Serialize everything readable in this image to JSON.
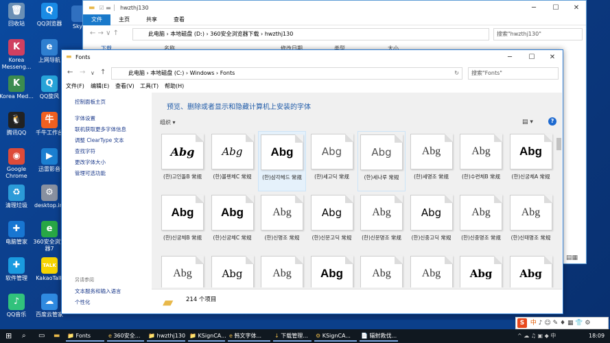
{
  "desktop": {
    "icons": [
      {
        "label": "回收站",
        "glyph": "🗑",
        "color": "#6a8fb5"
      },
      {
        "label": "QQ浏览器",
        "glyph": "Q",
        "color": "#1a8be5"
      },
      {
        "label": "Korea Messeng...",
        "glyph": "K",
        "color": "#d04060"
      },
      {
        "label": "上网导航",
        "glyph": "e",
        "color": "#2f7fd0"
      },
      {
        "label": "Korea Med...",
        "glyph": "K",
        "color": "#3c8c50"
      },
      {
        "label": "QQ旋风",
        "glyph": "Q",
        "color": "#27a3d8"
      },
      {
        "label": "腾讯QQ",
        "glyph": "🐧",
        "color": "#222222"
      },
      {
        "label": "千牛工作台",
        "glyph": "牛",
        "color": "#f06020"
      },
      {
        "label": "Google Chrome",
        "glyph": "◉",
        "color": "#dd4b39"
      },
      {
        "label": "迅雷影音",
        "glyph": "▶",
        "color": "#1b7fd1"
      },
      {
        "label": "清理垃圾",
        "glyph": "♻",
        "color": "#2b9bd8"
      },
      {
        "label": "desktop.ini",
        "glyph": "⚙",
        "color": "#8890a0"
      },
      {
        "label": "电脑管家",
        "glyph": "✚",
        "color": "#1876d2"
      },
      {
        "label": "360安全浏览器7",
        "glyph": "e",
        "color": "#28a745"
      },
      {
        "label": "软件管理",
        "glyph": "✚",
        "color": "#1a9be0"
      },
      {
        "label": "KakaoTalk",
        "glyph": "TALK",
        "color": "#f7d400"
      },
      {
        "label": "QQ音乐",
        "glyph": "♪",
        "color": "#31c27c"
      },
      {
        "label": "百度云管家",
        "glyph": "☁",
        "color": "#2f8ae0"
      }
    ],
    "truncated_sky": "Sky"
  },
  "back_window": {
    "title": "hwzthj130",
    "ribbon": [
      "文件",
      "主页",
      "共享",
      "查看"
    ],
    "path": [
      "此电脑",
      "本地磁盘 (D:)",
      "360安全浏览器下载",
      "hwzthj130"
    ],
    "search_placeholder": "搜索\"hwzthj130\"",
    "nav_item": "下载",
    "columns": [
      "名称",
      "修改日期",
      "类型",
      "大小"
    ]
  },
  "front_window": {
    "title": "Fonts",
    "path": [
      "此电脑",
      "本地磁盘 (C:)",
      "Windows",
      "Fonts"
    ],
    "search_placeholder": "搜索\"Fonts\"",
    "menu": [
      "文件(F)",
      "编辑(E)",
      "查看(V)",
      "工具(T)",
      "帮助(H)"
    ],
    "side": {
      "home": "控制面板主页",
      "links": [
        "字体设置",
        "联机获取更多字体信息",
        "调整 ClearType 文本",
        "查找字符",
        "更改字体大小",
        "管理可选功能"
      ],
      "see_also_header": "另请参阅",
      "see_also": [
        "文本服务和输入语言",
        "个性化"
      ]
    },
    "heading": "预览、删除或者显示和隐藏计算机上安装的字体",
    "organize": "组织 ▾",
    "sample": "Abg",
    "fonts": [
      {
        "name": "(한)고인돌B 常规",
        "style": "script"
      },
      {
        "name": "(한)볼펜체C 常规",
        "style": "script2"
      },
      {
        "name": "(한)삼각헤드 常规",
        "style": "bold",
        "selected": true
      },
      {
        "name": "(한)세고딕 常规",
        "style": "light"
      },
      {
        "name": "(한)세나루 常规",
        "style": "light",
        "hover": true
      },
      {
        "name": "(한)세명조 常规",
        "style": "serif"
      },
      {
        "name": "(한)수련체B 常规",
        "style": "serif"
      },
      {
        "name": "(한)신궁체A 常规",
        "style": "bold"
      },
      {
        "name": "(한)신궁체B 常规",
        "style": "bold"
      },
      {
        "name": "(한)신궁체C 常规",
        "style": "bold"
      },
      {
        "name": "(한)신명조 常规",
        "style": "serif"
      },
      {
        "name": "(한)신문고딕 常规",
        "style": "sans"
      },
      {
        "name": "(한)신문명조 常规",
        "style": "serif"
      },
      {
        "name": "(한)신중고딕 常规",
        "style": "sans"
      },
      {
        "name": "(한)신중명조 常规",
        "style": "serif"
      },
      {
        "name": "(한)신태명조 常规",
        "style": "serif"
      },
      {
        "name": "",
        "style": "serif"
      },
      {
        "name": "",
        "style": "serif2"
      },
      {
        "name": "",
        "style": "serif"
      },
      {
        "name": "",
        "style": "bold"
      },
      {
        "name": "",
        "style": "serif"
      },
      {
        "name": "",
        "style": "serif"
      },
      {
        "name": "",
        "style": "serifb"
      },
      {
        "name": "",
        "style": "serifb"
      }
    ],
    "item_count": "214 个项目"
  },
  "taskbar": {
    "items": [
      {
        "label": "Fonts",
        "glyph": "📁",
        "app": true
      },
      {
        "label": "360安全...",
        "glyph": "e",
        "app": true
      },
      {
        "label": "hwzthj130",
        "glyph": "📁",
        "app": true
      },
      {
        "label": "KSignCA...",
        "glyph": "📁",
        "app": true
      },
      {
        "label": "韩文字体...",
        "glyph": "e",
        "app": true
      },
      {
        "label": "下载管理...",
        "glyph": "↓",
        "app": true
      },
      {
        "label": "KSignCA...",
        "glyph": "⚙",
        "app": true
      },
      {
        "label": "辐射救伐...",
        "glyph": "📄",
        "app": true
      }
    ],
    "time": "18:09",
    "ime": "中"
  },
  "colors": {
    "accent": "#1979ca",
    "link": "#1c3b8c",
    "heading": "#1e5aa8",
    "taskbar": "#101820"
  }
}
